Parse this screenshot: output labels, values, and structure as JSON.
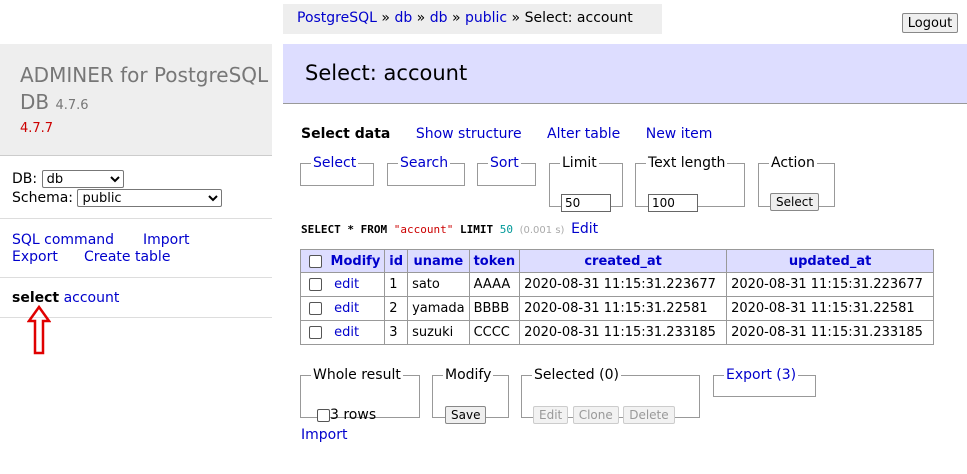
{
  "breadcrumb": {
    "items": [
      "PostgreSQL",
      "db",
      "db",
      "public"
    ],
    "separator": "»",
    "current": "Select: account"
  },
  "logout_label": "Logout",
  "sidebar": {
    "app_name": "ADMINER for PostgreSQL DB",
    "app_version_inline": "4.7.6",
    "app_version_new": "4.7.7",
    "db_label": "DB:",
    "db_value": "db",
    "schema_label": "Schema:",
    "schema_value": "public",
    "links": {
      "sql_command": "SQL command",
      "import": "Import",
      "export": "Export",
      "create_table": "Create table"
    },
    "table_select": "select",
    "table_name": "account"
  },
  "main": {
    "title": "Select: account",
    "tabs": {
      "select_data": "Select data",
      "show_structure": "Show structure",
      "alter_table": "Alter table",
      "new_item": "New item"
    },
    "fieldsets": {
      "select": "Select",
      "search": "Search",
      "sort": "Sort",
      "limit": "Limit",
      "limit_value": "50",
      "text_length": "Text length",
      "text_length_value": "100",
      "action": "Action",
      "action_button": "Select"
    },
    "sql": {
      "k1": "SELECT",
      "star": "*",
      "k2": "FROM",
      "table": "\"account\"",
      "k3": "LIMIT",
      "limit": "50",
      "time": "(0.001 s)",
      "edit": "Edit"
    },
    "table": {
      "modify_header": "Modify",
      "columns": [
        "id",
        "uname",
        "token",
        "created_at",
        "updated_at"
      ],
      "edit_label": "edit",
      "rows": [
        {
          "id": "1",
          "uname": "sato",
          "token": "AAAA",
          "created_at": "2020-08-31 11:15:31.223677",
          "updated_at": "2020-08-31 11:15:31.223677"
        },
        {
          "id": "2",
          "uname": "yamada",
          "token": "BBBB",
          "created_at": "2020-08-31 11:15:31.22581",
          "updated_at": "2020-08-31 11:15:31.22581"
        },
        {
          "id": "3",
          "uname": "suzuki",
          "token": "CCCC",
          "created_at": "2020-08-31 11:15:31.233185",
          "updated_at": "2020-08-31 11:15:31.233185"
        }
      ]
    },
    "bottom": {
      "whole_result": "Whole result",
      "rows_label": "3 rows",
      "modify": "Modify",
      "save": "Save",
      "selected": "Selected (0)",
      "edit": "Edit",
      "clone": "Clone",
      "delete": "Delete",
      "export": "Export (3)",
      "import": "Import"
    }
  },
  "colors": {
    "accent_bg": "#ddddff",
    "link": "#0000cc",
    "annotation_arrow": "#e00000"
  }
}
